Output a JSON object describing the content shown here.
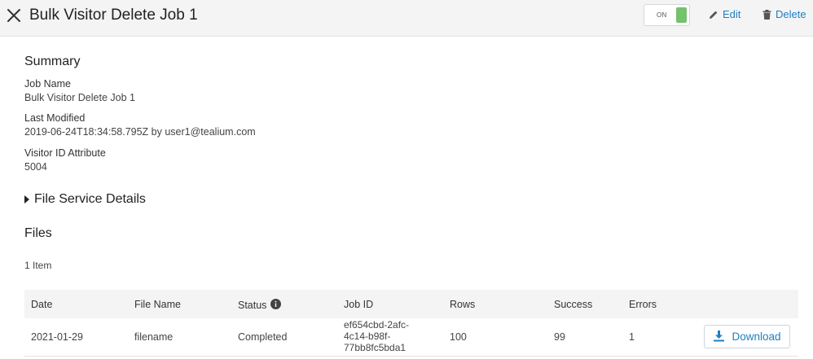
{
  "header": {
    "title": "Bulk Visitor Delete Job 1",
    "toggle_label": "ON",
    "edit_label": "Edit",
    "delete_label": "Delete"
  },
  "summary": {
    "heading": "Summary",
    "job_name_label": "Job Name",
    "job_name_value": "Bulk Visitor Delete Job 1",
    "last_modified_label": "Last Modified",
    "last_modified_value": "2019-06-24T18:34:58.795Z by user1@tealium.com",
    "visitor_id_label": "Visitor ID Attribute",
    "visitor_id_value": "5004"
  },
  "file_service": {
    "label": "File Service Details"
  },
  "files": {
    "heading": "Files",
    "item_count": "1 Item",
    "columns": [
      "Date",
      "File Name",
      "Status",
      "Job ID",
      "Rows",
      "Success",
      "Errors"
    ],
    "rows": [
      {
        "date": "2021-01-29",
        "file_name": "filename",
        "status": "Completed",
        "job_id_lines": [
          "ef654cbd-2afc-",
          "4c14-b98f-",
          "77bb8fc5bda1"
        ],
        "rows": "100",
        "success": "99",
        "errors": "1",
        "download_label": "Download"
      }
    ]
  },
  "colors": {
    "accent": "#1f7fc1",
    "toggle_on": "#73c26c",
    "header_bg": "#f4f4f4"
  },
  "icons": [
    "close-icon",
    "pencil-icon",
    "trash-icon",
    "caret-right-icon",
    "info-icon",
    "download-icon"
  ]
}
